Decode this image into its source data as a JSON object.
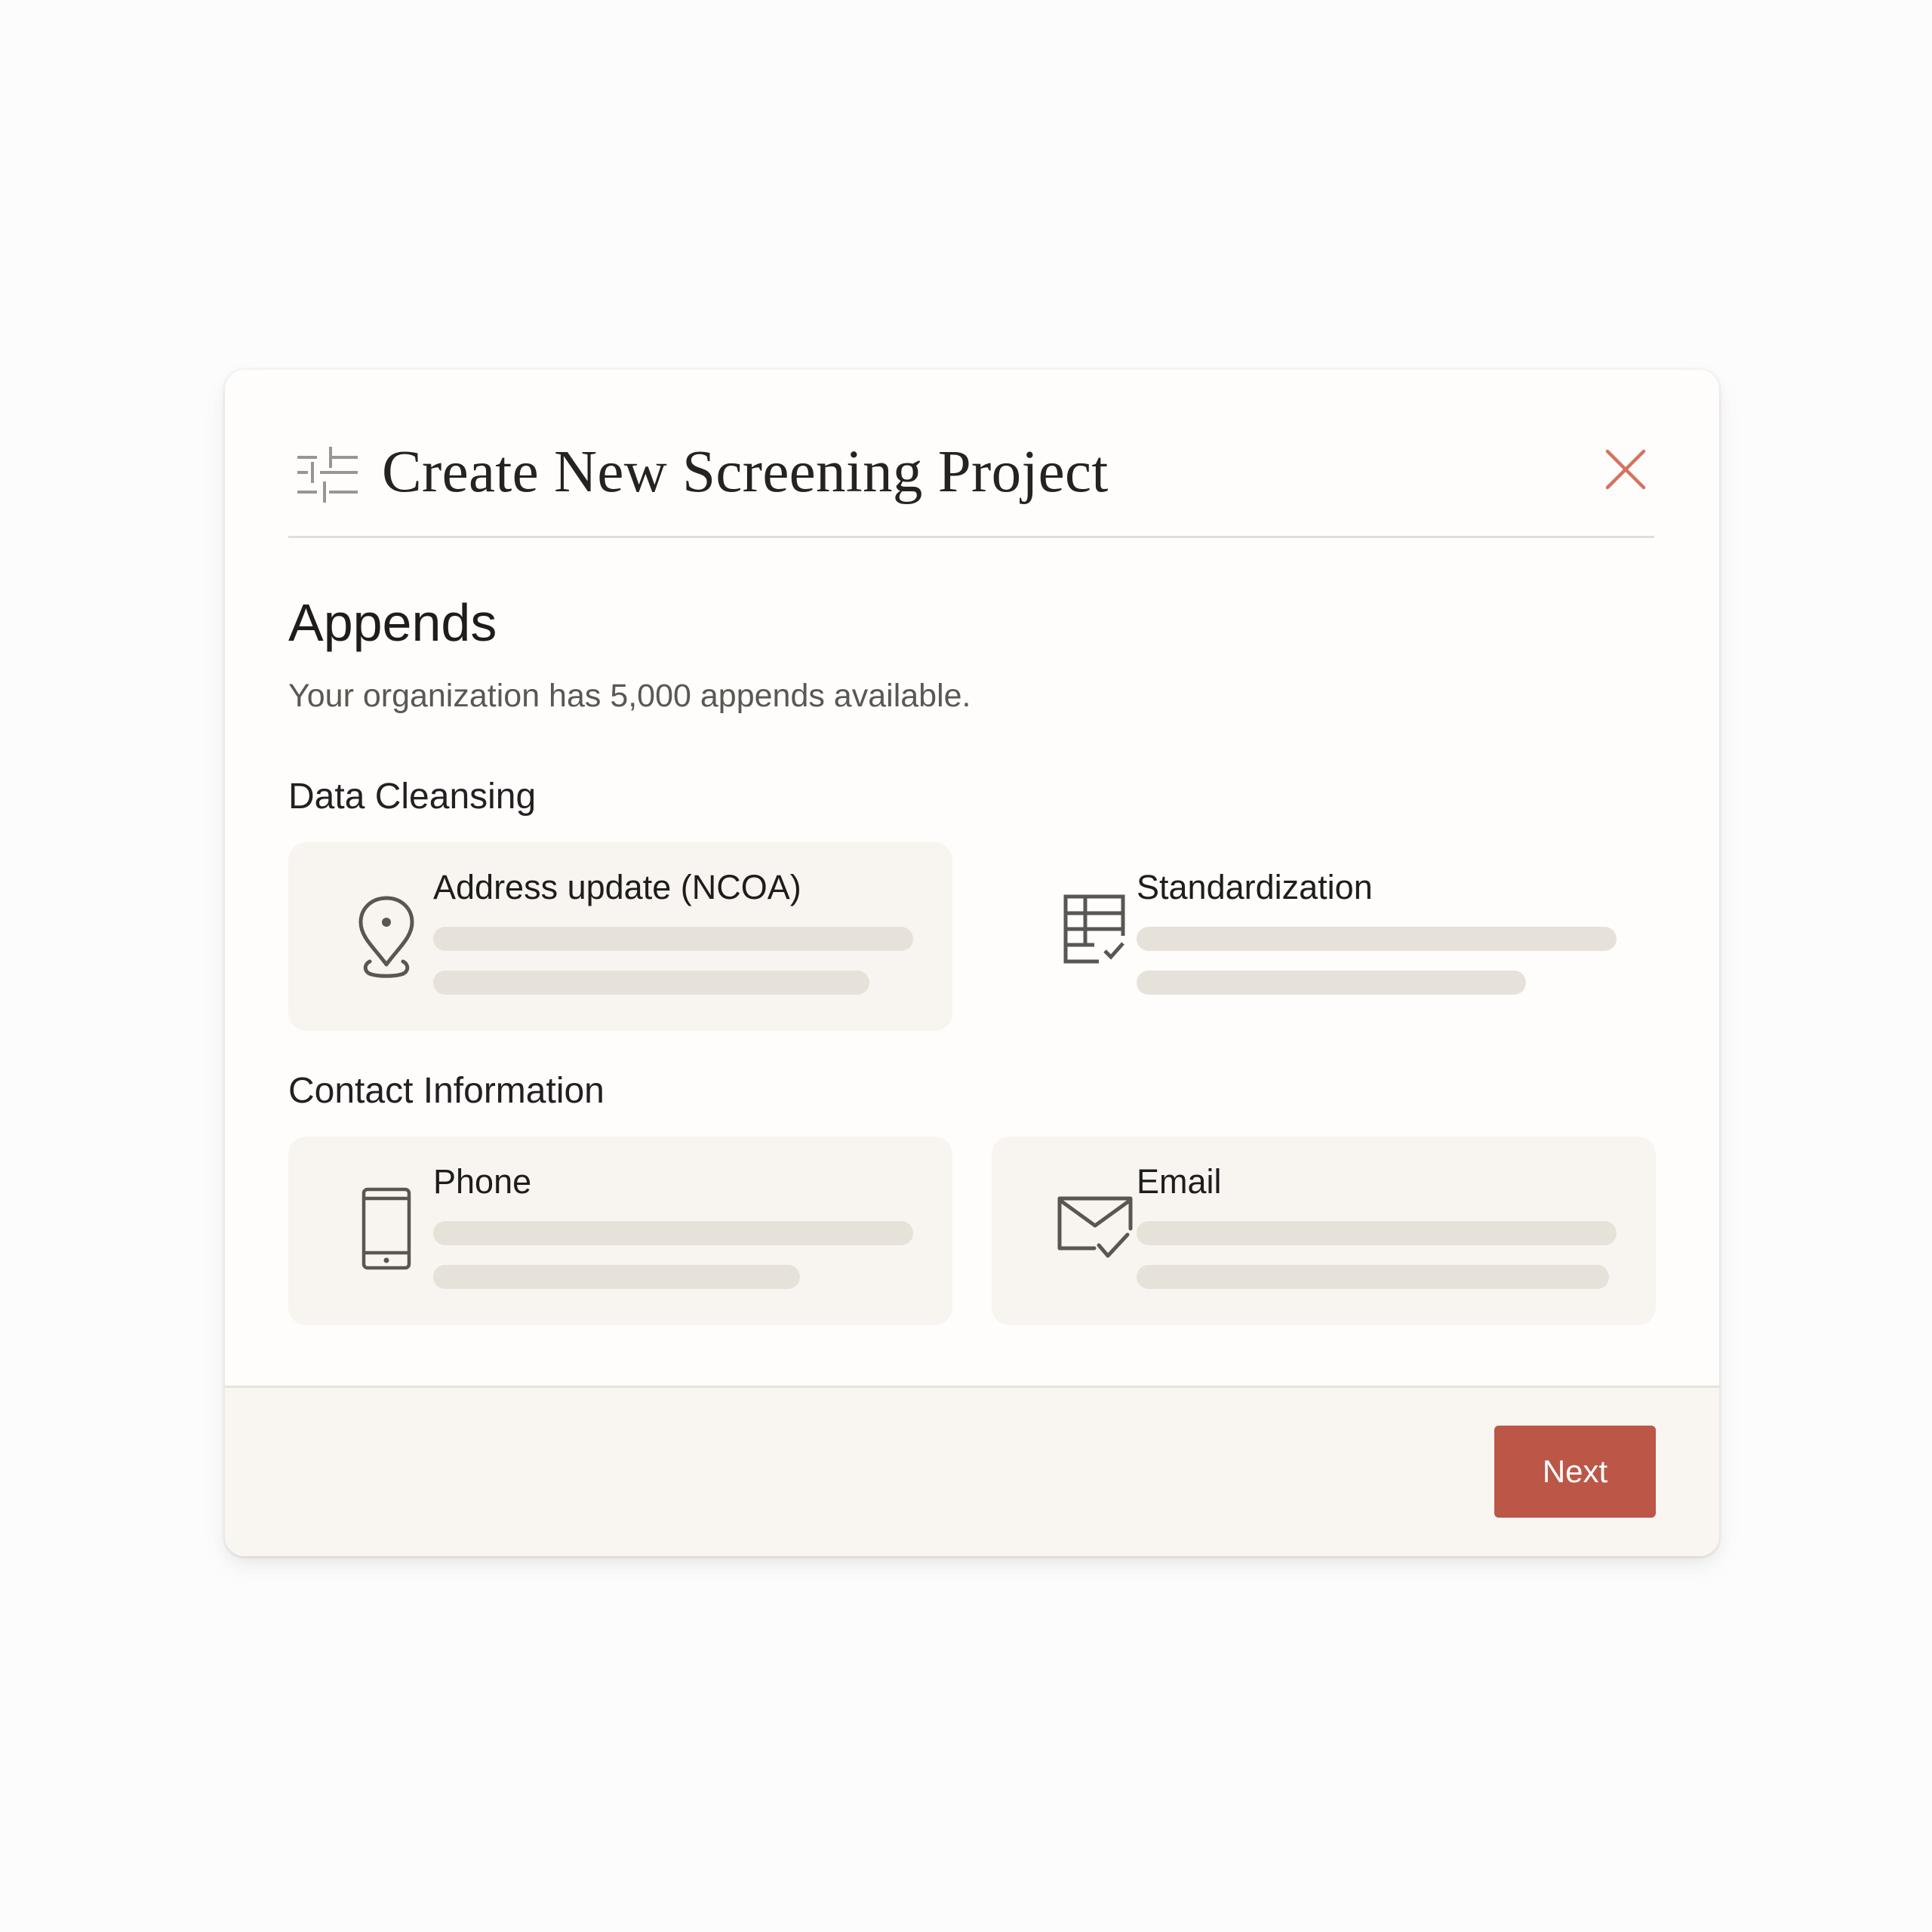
{
  "modal": {
    "title": "Create New Screening Project",
    "title_icon": "sliders-icon",
    "close_icon": "close-icon"
  },
  "appends": {
    "heading": "Appends",
    "subtitle": "Your organization has 5,000 appends available."
  },
  "groups": [
    {
      "title": "Data Cleansing",
      "options": [
        {
          "label": "Address update (NCOA)",
          "icon": "map-pin-icon",
          "highlighted": true
        },
        {
          "label": "Standardization",
          "icon": "table-check-icon",
          "highlighted": false
        }
      ]
    },
    {
      "title": "Contact Information",
      "options": [
        {
          "label": "Phone",
          "icon": "phone-icon",
          "highlighted": true
        },
        {
          "label": "Email",
          "icon": "mail-check-icon",
          "highlighted": true
        }
      ]
    }
  ],
  "footer": {
    "next_label": "Next"
  },
  "colors": {
    "accent": "#bc5647",
    "close_icon": "#d4735f",
    "card_bg": "#f8f4f0",
    "placeholder_bar": "#e6e2da",
    "footer_bg": "#f9f5f1"
  }
}
